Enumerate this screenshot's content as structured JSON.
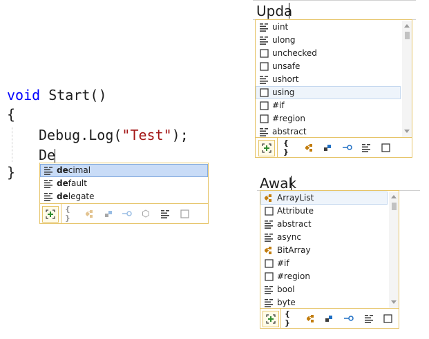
{
  "editor": {
    "top_fragment": "ʼʼ",
    "line1_keyword": "void",
    "line1_method": " Start()",
    "line2": "{",
    "line3_call": "Debug.Log(",
    "line3_string": "\"Test\"",
    "line3_end": ");",
    "line4_typed": "De",
    "line5": "}"
  },
  "popup_left": {
    "items": [
      {
        "bold": "de",
        "rest": "cimal",
        "icon": "keyword-icon"
      },
      {
        "bold": "de",
        "rest": "fault",
        "icon": "keyword-icon"
      },
      {
        "bold": "de",
        "rest": "legate",
        "icon": "keyword-icon"
      }
    ]
  },
  "box_update": {
    "typed": "Upda"
  },
  "popup_update": {
    "items": [
      {
        "label": "uint",
        "icon": "keyword-icon"
      },
      {
        "label": "ulong",
        "icon": "keyword-icon"
      },
      {
        "label": "unchecked",
        "icon": "snippet-icon"
      },
      {
        "label": "unsafe",
        "icon": "snippet-icon"
      },
      {
        "label": "ushort",
        "icon": "keyword-icon"
      },
      {
        "label": "using",
        "icon": "snippet-icon"
      },
      {
        "label": "#if",
        "icon": "snippet-icon"
      },
      {
        "label": "#region",
        "icon": "snippet-icon"
      },
      {
        "label": "abstract",
        "icon": "keyword-icon"
      }
    ]
  },
  "box_awake": {
    "typed": "Awak"
  },
  "popup_awake": {
    "items": [
      {
        "label": "ArrayList",
        "icon": "class-icon"
      },
      {
        "label": "Attribute",
        "icon": "snippet-icon"
      },
      {
        "label": "abstract",
        "icon": "keyword-icon"
      },
      {
        "label": "async",
        "icon": "keyword-icon"
      },
      {
        "label": "BitArray",
        "icon": "class-icon"
      },
      {
        "label": "#if",
        "icon": "snippet-icon"
      },
      {
        "label": "#region",
        "icon": "snippet-icon"
      },
      {
        "label": "bool",
        "icon": "keyword-icon"
      },
      {
        "label": "byte",
        "icon": "keyword-icon"
      }
    ]
  },
  "toolbar": {
    "namespace_label": "{ }"
  },
  "colors": {
    "keyword": "#0000ff",
    "string": "#a31515",
    "popup_border": "#e6c468",
    "selection": "#c9dcf7",
    "highlight": "#eef4fb"
  }
}
